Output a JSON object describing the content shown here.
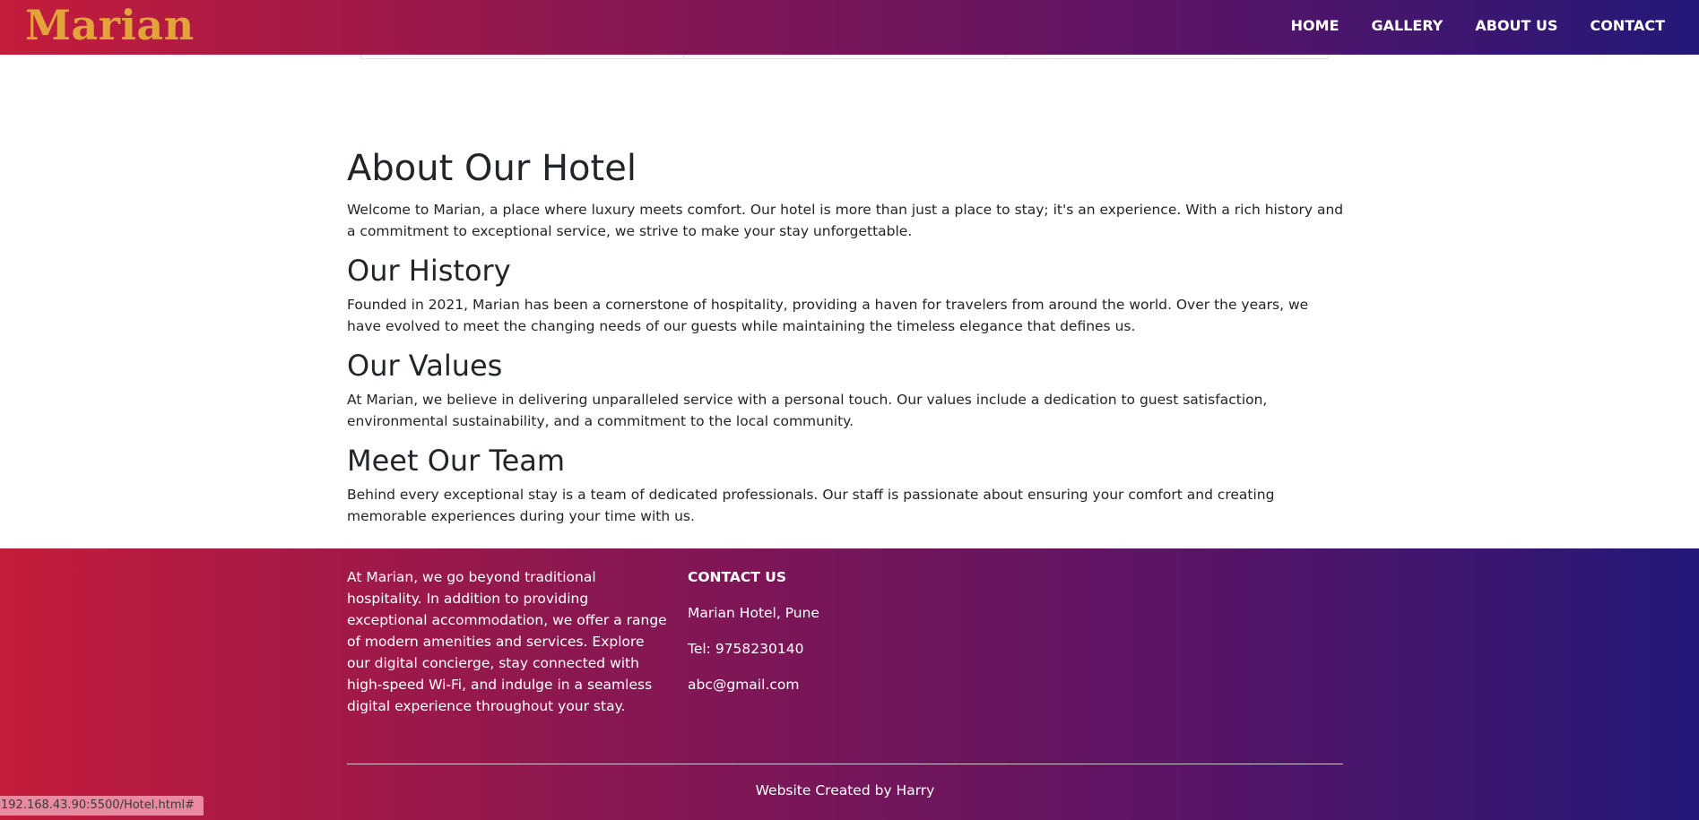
{
  "navbar": {
    "brand": "Marian",
    "links": [
      {
        "label": "HOME"
      },
      {
        "label": "GALLERY"
      },
      {
        "label": "ABOUT US"
      },
      {
        "label": "CONTACT"
      }
    ]
  },
  "about": {
    "title": "About Our Hotel",
    "intro": "Welcome to Marian, a place where luxury meets comfort. Our hotel is more than just a place to stay; it's an experience. With a rich history and a commitment to exceptional service, we strive to make your stay unforgettable.",
    "sections": [
      {
        "heading": "Our History",
        "text": "Founded in 2021, Marian has been a cornerstone of hospitality, providing a haven for travelers from around the world. Over the years, we have evolved to meet the changing needs of our guests while maintaining the timeless elegance that defines us."
      },
      {
        "heading": "Our Values",
        "text": "At Marian, we believe in delivering unparalleled service with a personal touch. Our values include a dedication to guest satisfaction, environmental sustainability, and a commitment to the local community."
      },
      {
        "heading": "Meet Our Team",
        "text": "Behind every exceptional stay is a team of dedicated professionals. Our staff is passionate about ensuring your comfort and creating memorable experiences during your time with us."
      }
    ]
  },
  "footer": {
    "about_text": "At Marian, we go beyond traditional hospitality. In addition to providing exceptional accommodation, we offer a range of modern amenities and services. Explore our digital concierge, stay connected with high-speed Wi-Fi, and indulge in a seamless digital experience throughout your stay.",
    "contact_heading": "CONTACT US",
    "address": "Marian Hotel, Pune",
    "phone": "Tel: 9758230140",
    "email": "abc@gmail.com",
    "credit": "Website Created by Harry"
  },
  "status_bar": {
    "url": "192.168.43.90:5500/Hotel.html#"
  },
  "colors": {
    "gradient_start": "#c41c3b",
    "gradient_end": "#231878",
    "brand": "#e2a43a",
    "text": "#212529"
  }
}
